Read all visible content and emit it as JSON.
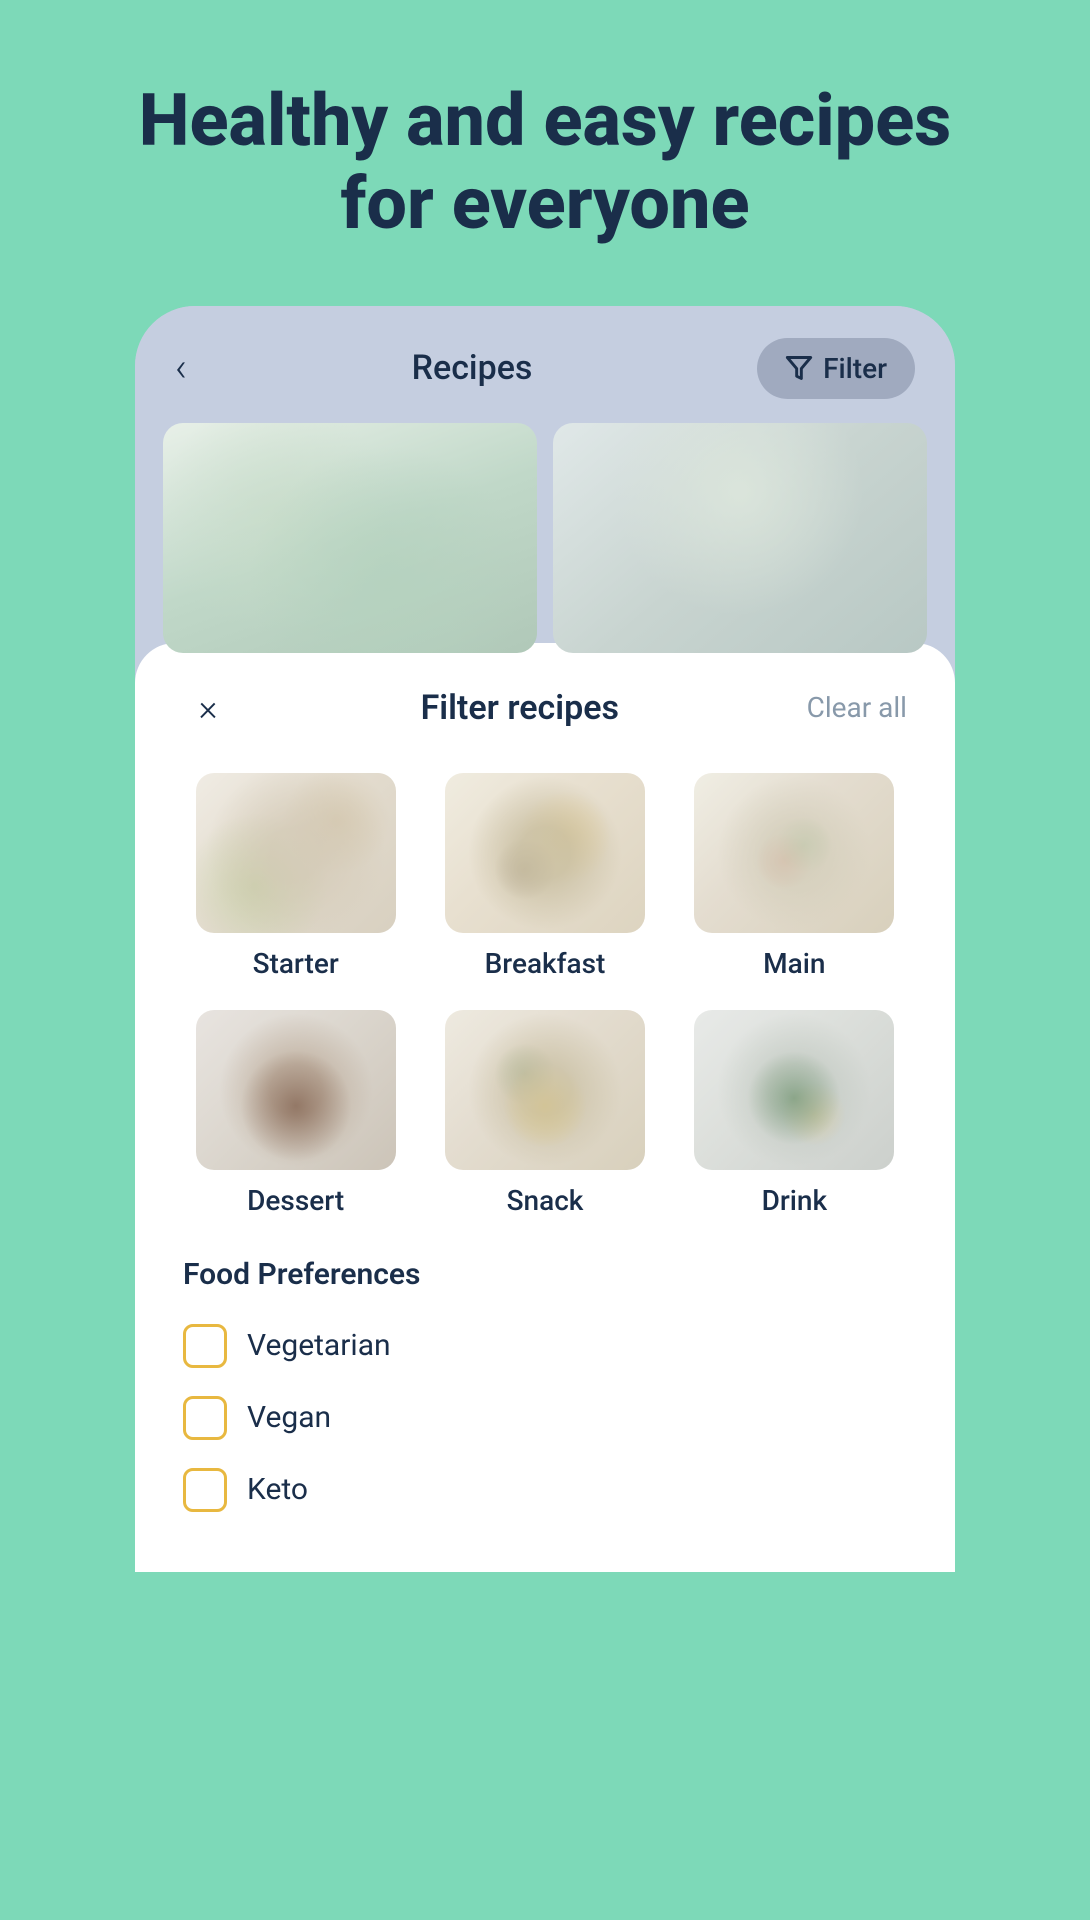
{
  "hero": {
    "title": "Healthy and easy recipes for everyone"
  },
  "header": {
    "back_label": "‹",
    "title": "Recipes",
    "filter_label": "Filter"
  },
  "filter_sheet": {
    "title": "Filter recipes",
    "clear_label": "Clear all",
    "close_label": "×",
    "categories": [
      {
        "id": "starter",
        "label": "Starter"
      },
      {
        "id": "breakfast",
        "label": "Breakfast"
      },
      {
        "id": "main",
        "label": "Main"
      },
      {
        "id": "dessert",
        "label": "Dessert"
      },
      {
        "id": "snack",
        "label": "Snack"
      },
      {
        "id": "drink",
        "label": "Drink"
      }
    ],
    "preferences_title": "Food Preferences",
    "preferences": [
      {
        "id": "vegetarian",
        "label": "Vegetarian"
      },
      {
        "id": "vegan",
        "label": "Vegan"
      },
      {
        "id": "keto",
        "label": "Keto"
      }
    ]
  }
}
